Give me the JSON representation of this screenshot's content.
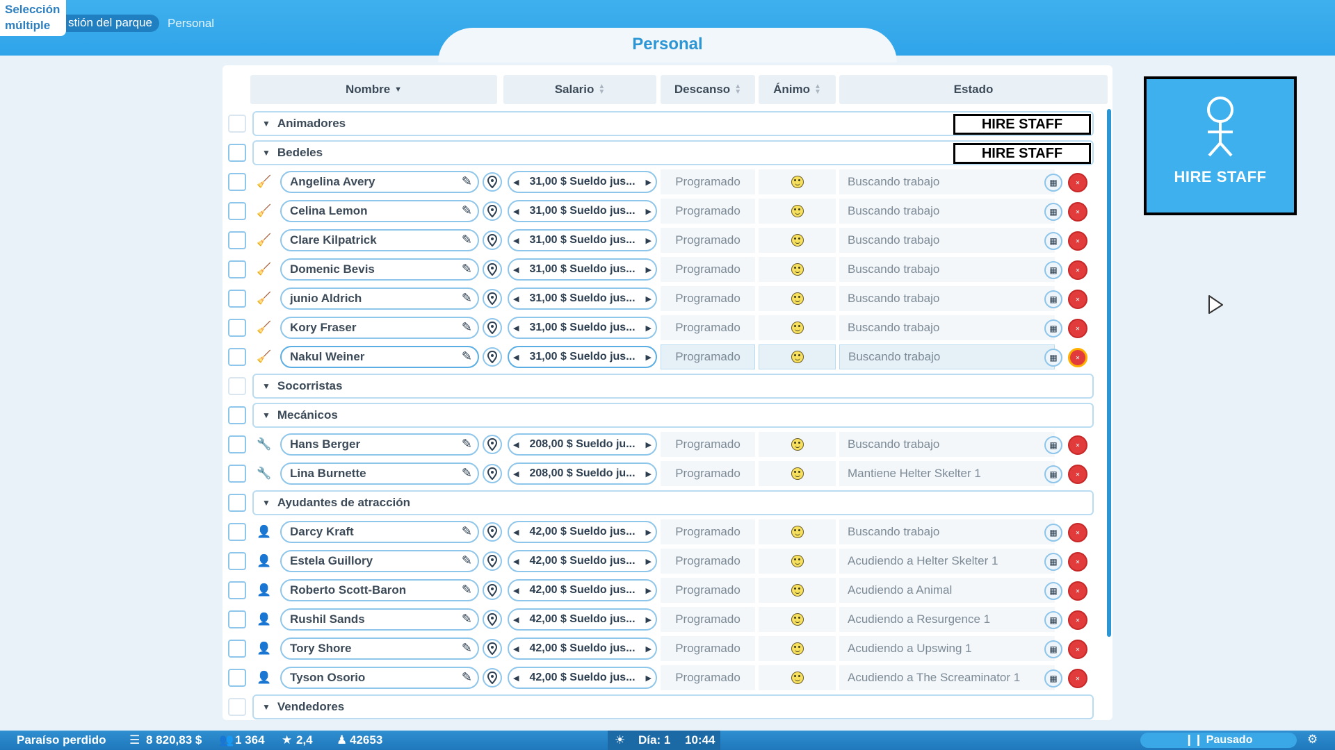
{
  "topbar": {
    "multi_select": "Selección múltiple",
    "breadcrumb_park": "stión del parque",
    "breadcrumb_staff": "Personal",
    "title": "Personal"
  },
  "columns": {
    "name": "Nombre",
    "salary": "Salario",
    "rest": "Descanso",
    "mood": "Ánimo",
    "status": "Estado"
  },
  "hire_tag": "HIRE STAFF",
  "hire_button_label": "HIRE STAFF",
  "groups": [
    {
      "label": "Animadores",
      "hire_tag": true,
      "members": []
    },
    {
      "label": "Bedeles",
      "hire_tag": true,
      "icon": "broom-icon",
      "members": [
        {
          "name": "Angelina Avery",
          "salary": "31,00 $ Sueldo jus...",
          "rest": "Programado",
          "status": "Buscando trabajo"
        },
        {
          "name": "Celina Lemon",
          "salary": "31,00 $ Sueldo jus...",
          "rest": "Programado",
          "status": "Buscando trabajo"
        },
        {
          "name": "Clare Kilpatrick",
          "salary": "31,00 $ Sueldo jus...",
          "rest": "Programado",
          "status": "Buscando trabajo"
        },
        {
          "name": "Domenic Bevis",
          "salary": "31,00 $ Sueldo jus...",
          "rest": "Programado",
          "status": "Buscando trabajo"
        },
        {
          "name": "junio Aldrich",
          "salary": "31,00 $ Sueldo jus...",
          "rest": "Programado",
          "status": "Buscando trabajo"
        },
        {
          "name": "Kory Fraser",
          "salary": "31,00 $ Sueldo jus...",
          "rest": "Programado",
          "status": "Buscando trabajo"
        },
        {
          "name": "Nakul Weiner",
          "salary": "31,00 $ Sueldo jus...",
          "rest": "Programado",
          "status": "Buscando trabajo",
          "selected": true
        }
      ]
    },
    {
      "label": "Socorristas",
      "members": []
    },
    {
      "label": "Mecánicos",
      "icon": "wrench-icon",
      "members": [
        {
          "name": "Hans Berger",
          "salary": "208,00 $ Sueldo ju...",
          "rest": "Programado",
          "status": "Buscando trabajo"
        },
        {
          "name": "Lina Burnette",
          "salary": "208,00 $ Sueldo ju...",
          "rest": "Programado",
          "status": "Mantiene Helter Skelter 1"
        }
      ]
    },
    {
      "label": "Ayudantes de atracción",
      "icon": "ride-helper-icon",
      "members": [
        {
          "name": "Darcy Kraft",
          "salary": "42,00 $ Sueldo jus...",
          "rest": "Programado",
          "status": "Buscando trabajo"
        },
        {
          "name": "Estela Guillory",
          "salary": "42,00 $ Sueldo jus...",
          "rest": "Programado",
          "status": "Acudiendo a Helter Skelter 1"
        },
        {
          "name": "Roberto Scott-Baron",
          "salary": "42,00 $ Sueldo jus...",
          "rest": "Programado",
          "status": "Acudiendo a Animal"
        },
        {
          "name": "Rushil Sands",
          "salary": "42,00 $ Sueldo jus...",
          "rest": "Programado",
          "status": "Acudiendo a Resurgence 1"
        },
        {
          "name": "Tory Shore",
          "salary": "42,00 $ Sueldo jus...",
          "rest": "Programado",
          "status": "Acudiendo a Upswing 1"
        },
        {
          "name": "Tyson Osorio",
          "salary": "42,00 $ Sueldo jus...",
          "rest": "Programado",
          "status": "Acudiendo a The Screaminator 1"
        }
      ]
    },
    {
      "label": "Vendedores",
      "members": []
    }
  ],
  "bottom_bar": {
    "park_name": "Paraíso perdido",
    "money": "8 820,83 $",
    "guests": "1 364",
    "rating": "2,4",
    "research": "42653",
    "day": "Día: 1",
    "time": "10:44",
    "paused": "Pausado"
  }
}
